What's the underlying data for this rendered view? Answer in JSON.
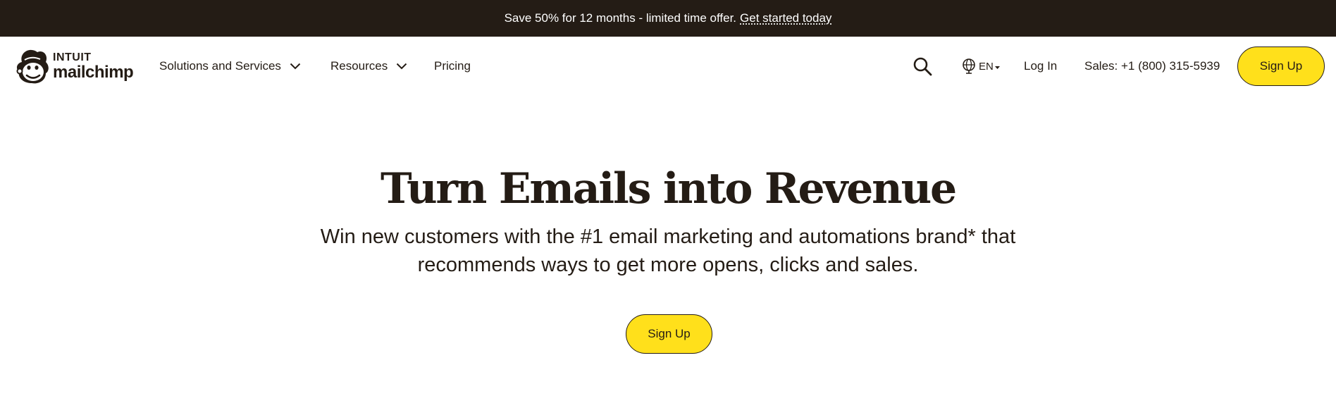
{
  "promo": {
    "text": "Save 50% for 12 months - limited time offer.",
    "link": "Get started today"
  },
  "logo": {
    "line1": "INTUIT",
    "line2": "mailchimp"
  },
  "nav": {
    "items": [
      {
        "label": "Solutions and Services",
        "has_dropdown": true
      },
      {
        "label": "Resources",
        "has_dropdown": true
      },
      {
        "label": "Pricing",
        "has_dropdown": false
      }
    ],
    "search_icon": "search-icon",
    "language": "EN",
    "language_icon": "globe-icon",
    "login": "Log In",
    "sales": "Sales: +1 (800) 315-5939",
    "signup": "Sign Up"
  },
  "hero": {
    "title": "Turn Emails into Revenue",
    "subtitle_line1": "Win new customers with the #1 email marketing and automations brand* that",
    "subtitle_line2": "recommends ways to get more opens, clicks and sales.",
    "cta": "Sign Up"
  },
  "colors": {
    "banner_bg": "#241c15",
    "text": "#241c15",
    "accent_yellow": "#ffe01b",
    "background": "#ffffff"
  }
}
